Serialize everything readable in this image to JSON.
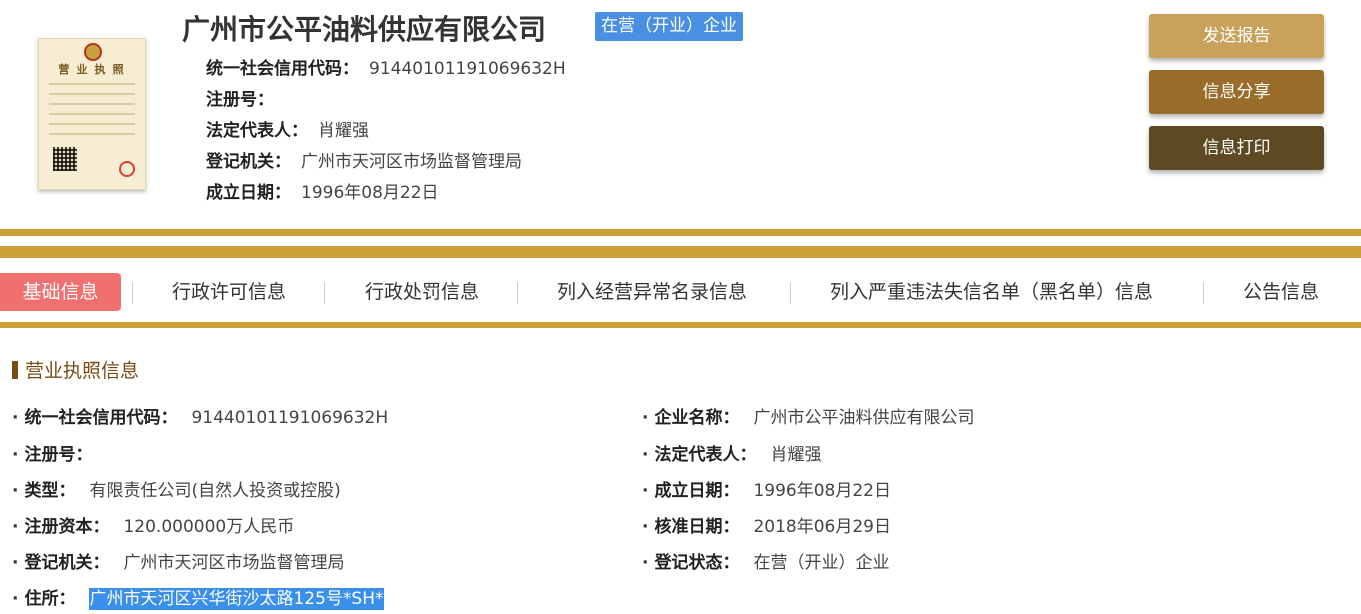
{
  "header": {
    "company_name": "广州市公平油料供应有限公司",
    "status_badge": "在营（开业）企业",
    "license_thumb_title": "营 业 执 照",
    "rows": [
      {
        "label": "统一社会信用代码：",
        "value": "91440101191069632H"
      },
      {
        "label": "注册号：",
        "value": ""
      },
      {
        "label": "法定代表人：",
        "value": "肖耀强"
      },
      {
        "label": "登记机关：",
        "value": "广州市天河区市场监督管理局"
      },
      {
        "label": "成立日期：",
        "value": "1996年08月22日"
      }
    ]
  },
  "actions": {
    "report": "发送报告",
    "share": "信息分享",
    "print": "信息打印"
  },
  "tabs": [
    {
      "label": "基础信息",
      "active": true
    },
    {
      "label": "行政许可信息"
    },
    {
      "label": "行政处罚信息"
    },
    {
      "label": "列入经营异常名录信息"
    },
    {
      "label": "列入严重违法失信名单（黑名单）信息"
    },
    {
      "label": "公告信息"
    }
  ],
  "section": {
    "title": "营业执照信息",
    "bullet": "·",
    "left": [
      {
        "label": "统一社会信用代码：",
        "value": "91440101191069632H"
      },
      {
        "label": "注册号：",
        "value": ""
      },
      {
        "label": "类型：",
        "value": "有限责任公司(自然人投资或控股)"
      },
      {
        "label": "注册资本：",
        "value": "120.000000万人民币"
      },
      {
        "label": "登记机关：",
        "value": "广州市天河区市场监督管理局"
      },
      {
        "label": "住所：",
        "value": "广州市天河区兴华街沙太路125号*SH*"
      }
    ],
    "right": [
      {
        "label": "企业名称：",
        "value": "广州市公平油料供应有限公司"
      },
      {
        "label": "法定代表人：",
        "value": "肖耀强"
      },
      {
        "label": "成立日期：",
        "value": "1996年08月22日"
      },
      {
        "label": "核准日期：",
        "value": "2018年06月29日"
      },
      {
        "label": "登记状态：",
        "value": "在营（开业）企业"
      }
    ]
  },
  "colors": {
    "accent_gold": "#c9a035",
    "badge_blue": "#4a90e2",
    "active_tab": "#f07070",
    "section_brown": "#7a4a14"
  }
}
